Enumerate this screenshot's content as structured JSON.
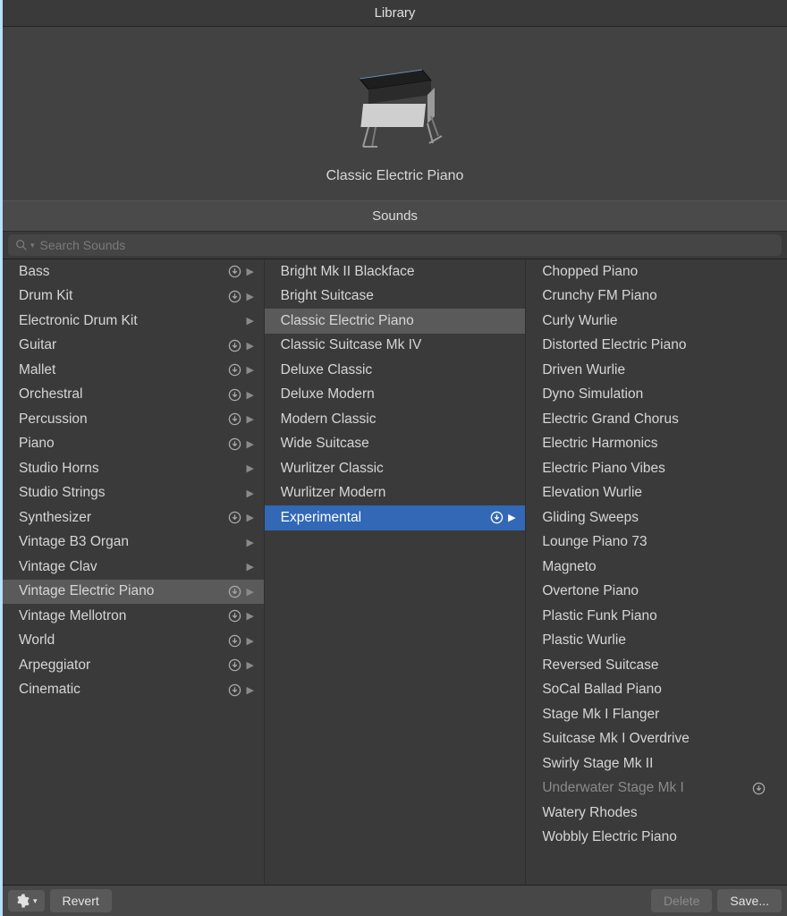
{
  "title": "Library",
  "preview": {
    "name": "Classic Electric Piano"
  },
  "sounds_header": "Sounds",
  "search": {
    "placeholder": "Search Sounds"
  },
  "columns": {
    "categories": [
      {
        "label": "Bass",
        "download": true,
        "chevron": true
      },
      {
        "label": "Drum Kit",
        "download": true,
        "chevron": true
      },
      {
        "label": "Electronic Drum Kit",
        "download": false,
        "chevron": true
      },
      {
        "label": "Guitar",
        "download": true,
        "chevron": true
      },
      {
        "label": "Mallet",
        "download": true,
        "chevron": true
      },
      {
        "label": "Orchestral",
        "download": true,
        "chevron": true
      },
      {
        "label": "Percussion",
        "download": true,
        "chevron": true
      },
      {
        "label": "Piano",
        "download": true,
        "chevron": true
      },
      {
        "label": "Studio Horns",
        "download": false,
        "chevron": true
      },
      {
        "label": "Studio Strings",
        "download": false,
        "chevron": true
      },
      {
        "label": "Synthesizer",
        "download": true,
        "chevron": true
      },
      {
        "label": "Vintage B3 Organ",
        "download": false,
        "chevron": true
      },
      {
        "label": "Vintage Clav",
        "download": false,
        "chevron": true
      },
      {
        "label": "Vintage Electric Piano",
        "download": true,
        "chevron": true,
        "selected": "grey"
      },
      {
        "label": "Vintage Mellotron",
        "download": true,
        "chevron": true
      },
      {
        "label": "World",
        "download": true,
        "chevron": true
      },
      {
        "label": "Arpeggiator",
        "download": true,
        "chevron": true
      },
      {
        "label": "Cinematic",
        "download": true,
        "chevron": true
      }
    ],
    "subcategories": [
      {
        "label": "Bright Mk II Blackface"
      },
      {
        "label": "Bright Suitcase"
      },
      {
        "label": "Classic Electric Piano",
        "selected": "grey"
      },
      {
        "label": "Classic Suitcase Mk IV"
      },
      {
        "label": "Deluxe Classic"
      },
      {
        "label": "Deluxe Modern"
      },
      {
        "label": "Modern Classic"
      },
      {
        "label": "Wide Suitcase"
      },
      {
        "label": "Wurlitzer Classic"
      },
      {
        "label": "Wurlitzer Modern"
      },
      {
        "label": "Experimental",
        "download": true,
        "chevron": true,
        "selected": "blue"
      }
    ],
    "presets": [
      {
        "label": "Chopped Piano"
      },
      {
        "label": "Crunchy FM Piano"
      },
      {
        "label": "Curly Wurlie"
      },
      {
        "label": "Distorted Electric Piano"
      },
      {
        "label": "Driven Wurlie"
      },
      {
        "label": "Dyno Simulation"
      },
      {
        "label": "Electric Grand Chorus"
      },
      {
        "label": "Electric Harmonics"
      },
      {
        "label": "Electric Piano Vibes"
      },
      {
        "label": "Elevation Wurlie"
      },
      {
        "label": "Gliding Sweeps"
      },
      {
        "label": "Lounge Piano 73"
      },
      {
        "label": "Magneto"
      },
      {
        "label": "Overtone Piano"
      },
      {
        "label": "Plastic Funk Piano"
      },
      {
        "label": "Plastic Wurlie"
      },
      {
        "label": "Reversed Suitcase"
      },
      {
        "label": "SoCal Ballad Piano"
      },
      {
        "label": "Stage Mk I Flanger"
      },
      {
        "label": "Suitcase Mk I Overdrive"
      },
      {
        "label": "Swirly Stage Mk II"
      },
      {
        "label": "Underwater Stage Mk I",
        "download": true,
        "dim": true
      },
      {
        "label": "Watery Rhodes"
      },
      {
        "label": "Wobbly Electric Piano"
      }
    ]
  },
  "footer": {
    "revert": "Revert",
    "delete": "Delete",
    "save": "Save..."
  }
}
